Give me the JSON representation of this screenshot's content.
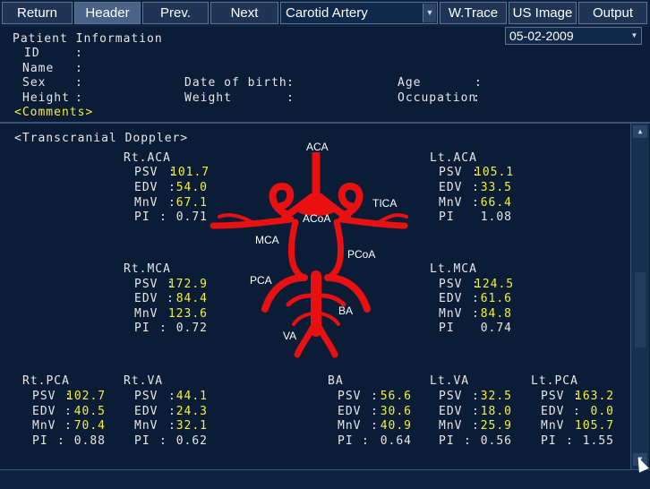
{
  "toolbar": {
    "return_label": "Return",
    "header_label": "Header",
    "prev_label": "Prev.",
    "next_label": "Next",
    "study_select": "Carotid Artery",
    "wtrace_label": "W.Trace",
    "usimage_label": "US Image",
    "output_label": "Output"
  },
  "patient": {
    "section_title": "Patient Information",
    "id_label": "ID",
    "name_label": "Name",
    "sex_label": "Sex",
    "height_label": "Height",
    "dob_label": "Date of birth",
    "weight_label": "Weight",
    "age_label": "Age",
    "occupation_label": "Occupation",
    "colon": ":",
    "comments_label": "<Comments>",
    "date_value": "05-02-2009"
  },
  "report": {
    "title": "<Transcranial Doppler>",
    "param_labels": {
      "psv": "PSV",
      "edv": "EDV",
      "mnv": "MnV",
      "pi": "PI"
    },
    "vessel_labels": {
      "aca": "ACA",
      "tica": "TICA",
      "acoa": "ACoA",
      "mca": "MCA",
      "pcoa": "PCoA",
      "pca": "PCA",
      "ba": "BA",
      "va": "VA"
    },
    "rt_aca": {
      "title": "Rt.ACA",
      "psv": "101.7",
      "edv": "54.0",
      "mnv": "67.1",
      "pi": "0.71"
    },
    "lt_aca": {
      "title": "Lt.ACA",
      "psv": "105.1",
      "edv": "33.5",
      "mnv": "66.4",
      "pi": "1.08"
    },
    "rt_mca": {
      "title": "Rt.MCA",
      "psv": "172.9",
      "edv": "84.4",
      "mnv": "123.6",
      "pi": "0.72"
    },
    "lt_mca": {
      "title": "Lt.MCA",
      "psv": "124.5",
      "edv": "61.6",
      "mnv": "84.8",
      "pi": "0.74"
    },
    "rt_pca": {
      "title": "Rt.PCA",
      "psv": "102.7",
      "edv": "40.5",
      "mnv": "70.4",
      "pi": "0.88"
    },
    "rt_va": {
      "title": "Rt.VA",
      "psv": "44.1",
      "edv": "24.3",
      "mnv": "32.1",
      "pi": "0.62"
    },
    "ba": {
      "title": "BA",
      "psv": "56.6",
      "edv": "30.6",
      "mnv": "40.9",
      "pi": "0.64"
    },
    "lt_va": {
      "title": "Lt.VA",
      "psv": "32.5",
      "edv": "18.0",
      "mnv": "25.9",
      "pi": "0.56"
    },
    "lt_pca": {
      "title": "Lt.PCA",
      "psv": "163.2",
      "edv": "0.0",
      "mnv": "105.7",
      "pi": "1.55"
    }
  },
  "colors": {
    "background": "#0a1c36",
    "value_yellow": "#f5f03c",
    "artery_red": "#e81010",
    "button_active": "#4a6287"
  },
  "icons": {
    "dropdown": "chevron-down-icon",
    "scroll_up": "scroll-up-icon",
    "scroll_down": "scroll-down-icon",
    "pointer": "mouse-pointer-icon"
  }
}
